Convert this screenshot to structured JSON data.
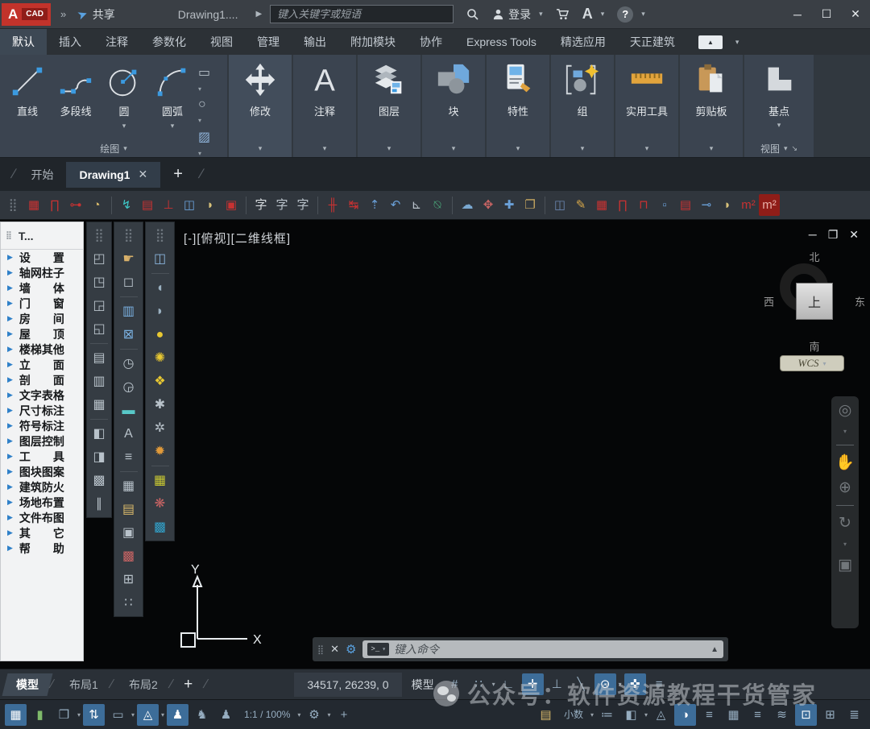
{
  "glyphs": {
    "dd": "▾",
    "slash": "/",
    "grip": "⣿",
    "diag": "↘",
    "caret": "▶",
    "qat": "»"
  },
  "window": {
    "logo_a": "A",
    "logo_cad": "CAD",
    "share_label": "共享",
    "doc_title": "Drawing1....",
    "search_placeholder": "键入关键字或短语",
    "signin_label": "登录",
    "buttons": {
      "minimize": "─",
      "maximize": "☐",
      "close": "✕"
    }
  },
  "ribbon": {
    "tabs": [
      {
        "label": "默认",
        "active": true
      },
      {
        "label": "插入"
      },
      {
        "label": "注释"
      },
      {
        "label": "参数化"
      },
      {
        "label": "视图"
      },
      {
        "label": "管理"
      },
      {
        "label": "输出"
      },
      {
        "label": "附加模块"
      },
      {
        "label": "协作"
      },
      {
        "label": "Express Tools"
      },
      {
        "label": "精选应用"
      },
      {
        "label": "天正建筑"
      }
    ],
    "draw": {
      "tools": [
        {
          "label": "直线"
        },
        {
          "label": "多段线"
        },
        {
          "label": "圆"
        },
        {
          "label": "圆弧"
        }
      ],
      "small": [
        {
          "name": "rectangle-tool",
          "glyph": "▭",
          "dd": true
        },
        {
          "name": "ellipse-tool",
          "glyph": "○",
          "dd": true
        },
        {
          "name": "hatch-tool",
          "glyph": "▨",
          "color": "#8fb3d9",
          "dd": true
        }
      ],
      "footer": "绘图"
    },
    "panels": [
      {
        "label": "修改"
      },
      {
        "label": "注释"
      },
      {
        "label": "图层"
      },
      {
        "label": "块"
      },
      {
        "label": "特性"
      },
      {
        "label": "组"
      },
      {
        "label": "实用工具"
      },
      {
        "label": "剪贴板"
      }
    ],
    "base": {
      "label": "基点",
      "footer": "视图"
    }
  },
  "file_tabs": {
    "start": "开始",
    "active": "Drawing1",
    "close": "✕",
    "add": "+"
  },
  "tz_toolbar": {
    "icons": [
      {
        "name": "toolbar-grip",
        "glyph": "⣿",
        "color": "#6d757d"
      },
      {
        "name": "tz-axis-grid",
        "glyph": "▦",
        "color": "#c83232"
      },
      {
        "name": "tz-standard-column",
        "glyph": "∏",
        "color": "#c83232"
      },
      {
        "name": "tz-wall-line",
        "glyph": "⊶",
        "color": "#c83232"
      },
      {
        "name": "tz-arc-door",
        "glyph": "◔",
        "color": "#d8b96a"
      },
      {
        "sep": true
      },
      {
        "name": "tz-elevation-window",
        "glyph": "↯",
        "color": "#3ec8c8"
      },
      {
        "name": "tz-corner-window",
        "glyph": "▤",
        "color": "#c83232"
      },
      {
        "name": "tz-wall-base",
        "glyph": "⊥",
        "color": "#c83232"
      },
      {
        "name": "tz-door-insert",
        "glyph": "◫",
        "color": "#6aa0d8"
      },
      {
        "name": "tz-fan-window",
        "glyph": "◗",
        "color": "#d8c27a"
      },
      {
        "name": "tz-hole",
        "glyph": "▣",
        "color": "#c83232"
      },
      {
        "sep": true
      },
      {
        "name": "tz-text-style",
        "glyph": "字",
        "color": "#d5dade"
      },
      {
        "name": "tz-single-text",
        "glyph": "字",
        "color": "#b9c2ca"
      },
      {
        "name": "tz-multi-text",
        "glyph": "字",
        "color": "#b9c2ca"
      },
      {
        "sep": true
      },
      {
        "name": "tz-dim-axis",
        "glyph": "╫",
        "color": "#c83232"
      },
      {
        "name": "tz-dim-linear",
        "glyph": "↹",
        "color": "#c83232"
      },
      {
        "name": "tz-dim-continue",
        "glyph": "⇡",
        "color": "#6aa0d8"
      },
      {
        "name": "tz-dim-arc",
        "glyph": "↶",
        "color": "#6aa0d8"
      },
      {
        "name": "tz-dim-angle",
        "glyph": "⊾",
        "color": "#b9c2ca"
      },
      {
        "name": "tz-symbol-elevation",
        "glyph": "⍉",
        "color": "#4aa87a"
      },
      {
        "sep": true
      },
      {
        "name": "tz-cloud-mark",
        "glyph": "☁",
        "color": "#7aa8d0"
      },
      {
        "name": "tz-move-label",
        "glyph": "✥",
        "color": "#c86464"
      },
      {
        "name": "tz-pan-view",
        "glyph": "✚",
        "color": "#6aa0d8"
      },
      {
        "name": "tz-copy-clip",
        "glyph": "❐",
        "color": "#c8a860"
      },
      {
        "sep": true
      },
      {
        "name": "tz-insert-frame",
        "glyph": "◫",
        "color": "#6a86b0"
      },
      {
        "name": "tz-sheet-edit",
        "glyph": "✎",
        "color": "#d8a84a"
      },
      {
        "name": "tz-axis-grid-2",
        "glyph": "▦",
        "color": "#c83232"
      },
      {
        "name": "tz-column-2",
        "glyph": "∏",
        "color": "#c83232"
      },
      {
        "name": "tz-beam",
        "glyph": "⊓",
        "color": "#c83232"
      },
      {
        "name": "tz-window-2",
        "glyph": "▫",
        "color": "#6aa0d8"
      },
      {
        "name": "tz-wall-2",
        "glyph": "▤",
        "color": "#c83232"
      },
      {
        "name": "tz-door-2",
        "glyph": "⊸",
        "color": "#6aa0d8"
      },
      {
        "name": "tz-fan-2",
        "glyph": "◗",
        "color": "#d8c27a"
      },
      {
        "name": "tz-area-m2",
        "glyph": "m²",
        "color": "#c83232"
      },
      {
        "name": "tz-sum-area",
        "glyph": "m²",
        "color": "#e8b0a8",
        "on": true
      }
    ]
  },
  "palette": {
    "title": "T...",
    "items": [
      {
        "id": "settings",
        "label": "设　　置"
      },
      {
        "id": "axis-column",
        "label": "轴网柱子"
      },
      {
        "id": "wall",
        "label": "墙　　体"
      },
      {
        "id": "door-window",
        "label": "门　　窗"
      },
      {
        "id": "room",
        "label": "房　　间"
      },
      {
        "id": "roof",
        "label": "屋　　顶"
      },
      {
        "id": "stairs-other",
        "label": "楼梯其他"
      },
      {
        "id": "elevation",
        "label": "立　　面"
      },
      {
        "id": "section",
        "label": "剖　　面"
      },
      {
        "id": "text-table",
        "label": "文字表格"
      },
      {
        "id": "dimension",
        "label": "尺寸标注"
      },
      {
        "id": "symbol",
        "label": "符号标注"
      },
      {
        "id": "layer-control",
        "label": "图层控制"
      },
      {
        "id": "tools",
        "label": "工　　具"
      },
      {
        "id": "block-pattern",
        "label": "图块图案"
      },
      {
        "id": "fire-protection",
        "label": "建筑防火"
      },
      {
        "id": "site-layout",
        "label": "场地布置"
      },
      {
        "id": "file-layout",
        "label": "文件布图"
      },
      {
        "id": "other",
        "label": "其　　它"
      },
      {
        "id": "help",
        "label": "帮　　助"
      }
    ]
  },
  "vbars": {
    "col1": [
      {
        "name": "vbar-grip",
        "glyph": "⣿",
        "color": "#6d757d"
      },
      {
        "name": "bring-to-front",
        "glyph": "◰"
      },
      {
        "name": "send-to-back",
        "glyph": "◳"
      },
      {
        "name": "bring-above",
        "glyph": "◲"
      },
      {
        "name": "send-under",
        "glyph": "◱"
      },
      {
        "sep": true
      },
      {
        "name": "text-to-front",
        "glyph": "▤"
      },
      {
        "name": "hatch-to-back",
        "glyph": "▥"
      },
      {
        "name": "dims-to-front",
        "glyph": "▦"
      },
      {
        "sep": true
      },
      {
        "name": "white-out",
        "glyph": "◧"
      },
      {
        "name": "wipeout-frame",
        "glyph": "◨"
      },
      {
        "name": "pattern-fill",
        "glyph": "▩"
      },
      {
        "name": "double-line",
        "glyph": "∥"
      }
    ],
    "col2": [
      {
        "name": "vbar-grip",
        "glyph": "⣿",
        "color": "#6d757d"
      },
      {
        "name": "object-edit",
        "glyph": "☛",
        "color": "#d8b06a"
      },
      {
        "name": "zoom-object",
        "glyph": "◻"
      },
      {
        "sep": true
      },
      {
        "name": "layer-columns",
        "glyph": "▥",
        "color": "#7ab0e0"
      },
      {
        "name": "layer-off-box",
        "glyph": "⊠",
        "color": "#7ab0e0"
      },
      {
        "sep": true
      },
      {
        "name": "pline-vertex-add",
        "glyph": "◷"
      },
      {
        "name": "pline-vertex-del",
        "glyph": "◶"
      },
      {
        "name": "match-properties",
        "glyph": "▬",
        "color": "#58c8c8"
      },
      {
        "name": "text-along-line",
        "glyph": "A"
      },
      {
        "name": "line-spacing",
        "glyph": "≡"
      },
      {
        "sep": true
      },
      {
        "name": "grid-tool",
        "glyph": "▦"
      },
      {
        "name": "ruler-tool",
        "glyph": "▤",
        "color": "#d8b96a"
      },
      {
        "name": "image-frame",
        "glyph": "▣"
      },
      {
        "name": "color-swatches",
        "glyph": "▩",
        "color": "#c86464"
      },
      {
        "name": "table-tool",
        "glyph": "⊞"
      },
      {
        "name": "dots-tool",
        "glyph": "∷"
      }
    ],
    "col3": [
      {
        "name": "vbar-grip",
        "glyph": "⣿",
        "color": "#6d757d"
      },
      {
        "name": "insert-view",
        "glyph": "◫",
        "color": "#8ab4dc"
      },
      {
        "sep": true
      },
      {
        "name": "layer-light-off",
        "glyph": "◖",
        "color": "#9ab0c0"
      },
      {
        "name": "layer-light-copy",
        "glyph": "◗",
        "color": "#9ab0c0"
      },
      {
        "name": "bulb-on",
        "glyph": "●",
        "color": "#e8c832"
      },
      {
        "name": "bulb-burst",
        "glyph": "✺",
        "color": "#e8c832"
      },
      {
        "name": "bulb-lock",
        "glyph": "❖",
        "color": "#e8c832"
      },
      {
        "name": "freeze-layer",
        "glyph": "✱"
      },
      {
        "name": "freeze-viewport",
        "glyph": "✲"
      },
      {
        "name": "sun-brightness",
        "glyph": "✹",
        "color": "#e09a3a"
      },
      {
        "sep": true
      },
      {
        "name": "swatch-yellow",
        "glyph": "▦",
        "color": "#c8c832"
      },
      {
        "name": "swatch-red",
        "glyph": "❋",
        "color": "#c86464"
      },
      {
        "name": "swatch-blue",
        "glyph": "▩",
        "color": "#32a0c8"
      }
    ]
  },
  "viewport": {
    "controls": "[-][俯视][二维线框]",
    "win": {
      "minimize": "─",
      "restore": "❐",
      "close": "✕"
    },
    "viewcube": {
      "north": "北",
      "south": "南",
      "west": "西",
      "east": "东",
      "top": "上",
      "ucs": "WCS"
    },
    "navbar": [
      {
        "name": "navigation-wheel",
        "glyph": "◎",
        "dd": true
      },
      {
        "sep": true
      },
      {
        "name": "pan-hand",
        "glyph": "✋"
      },
      {
        "name": "zoom-tool",
        "glyph": "⊕"
      },
      {
        "sep": true
      },
      {
        "name": "orbit-tool",
        "glyph": "↻",
        "dd": true
      },
      {
        "name": "show-motion",
        "glyph": "▣"
      }
    ]
  },
  "ucs_axis": {
    "x": "X",
    "y": "Y"
  },
  "command": {
    "prompt_chip": ">_",
    "placeholder": "键入命令",
    "expand": "▲"
  },
  "status": {
    "layout_tabs": [
      {
        "label": "模型",
        "active": true
      },
      {
        "label": "布局1"
      },
      {
        "label": "布局2"
      }
    ],
    "add_tab": "+",
    "coords": "34517, 26239, 0",
    "model_button": "模型",
    "row1_icons": [
      {
        "name": "grid-display",
        "glyph": "#"
      },
      {
        "name": "snap-mode",
        "glyph": "∷",
        "dd": true
      },
      {
        "name": "ortho-mode",
        "glyph": "∟"
      },
      {
        "name": "polar-tracking",
        "glyph": "✛",
        "on": true
      },
      {
        "name": "isometric-drafting",
        "glyph": "⊥"
      },
      {
        "name": "object-snap-tracking",
        "glyph": "╲"
      },
      {
        "name": "object-snap",
        "glyph": "⊙",
        "on": true,
        "dd": true
      },
      {
        "name": "dynamic-input",
        "glyph": "✜",
        "on": true
      },
      {
        "name": "annotation-monitor",
        "glyph": "≡"
      }
    ],
    "row2_left": [
      {
        "name": "snap-to-drawing-grid",
        "glyph": "▦",
        "on": true
      },
      {
        "name": "quick-measure",
        "glyph": "▮",
        "color": "#7fba6a"
      },
      {
        "name": "workspace-cube",
        "glyph": "❒",
        "dd": true
      },
      {
        "name": "ucs-toggle",
        "glyph": "⇅",
        "on": true
      },
      {
        "name": "selection-cycling",
        "glyph": "▭",
        "dd": true
      },
      {
        "name": "navigation-cube-toggle",
        "glyph": "◬",
        "on": true,
        "dd": true
      },
      {
        "name": "annotation-visibility",
        "glyph": "♟",
        "on": true
      },
      {
        "name": "annotation-autoscale",
        "glyph": "♞"
      },
      {
        "name": "annotation-scale-sync",
        "glyph": "♟"
      },
      {
        "name": "annotation-scale",
        "text": "1:1 / 100%",
        "dd": true
      },
      {
        "name": "workspace-settings",
        "glyph": "⚙",
        "dd": true
      },
      {
        "name": "add-status-item",
        "glyph": "+"
      }
    ],
    "row2_right": [
      {
        "name": "units-ruler",
        "glyph": "▤",
        "color": "#d8b96a"
      },
      {
        "name": "units-format",
        "text": "小数",
        "dd": true
      },
      {
        "name": "properties-monitor",
        "glyph": "≔"
      },
      {
        "name": "ui-lock",
        "glyph": "◧",
        "dd": true
      },
      {
        "name": "object-isolate",
        "glyph": "◬"
      },
      {
        "name": "graphics-performance",
        "glyph": "◑",
        "on": true
      },
      {
        "name": "lineweight-display",
        "glyph": "≡"
      },
      {
        "name": "transparency-display",
        "glyph": "▦"
      },
      {
        "name": "selection-filter",
        "glyph": "≡"
      },
      {
        "name": "gizmo-toggle",
        "glyph": "≋"
      },
      {
        "name": "clean-screen",
        "glyph": "⊡",
        "on": true
      },
      {
        "name": "fullscreen-toggle",
        "glyph": "⊞"
      },
      {
        "name": "customization-menu",
        "glyph": "≣"
      }
    ]
  },
  "watermark": {
    "text": "公众号：软件资源教程干货管家"
  }
}
